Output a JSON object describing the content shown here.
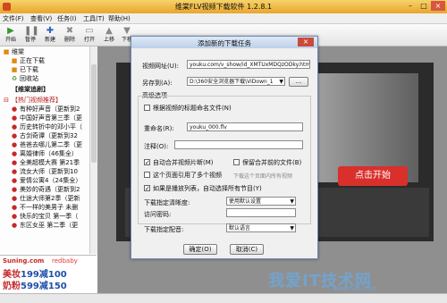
{
  "window": {
    "title": "维棠FLV视频下载软件 1.2.8.1"
  },
  "menu": [
    "文件(F)",
    "查看(V)",
    "任务(I)",
    "工具(T)",
    "帮助(H)"
  ],
  "toolbar": [
    "开始",
    "暂停",
    "新建",
    "删除",
    "打开",
    "上移",
    "下移"
  ],
  "sidebar": {
    "items": [
      {
        "label": "维棠",
        "level": 0
      },
      {
        "label": "正在下载",
        "level": 1
      },
      {
        "label": "已下载",
        "level": 1
      },
      {
        "label": "回收站",
        "level": 1
      },
      {
        "label": "【维棠追剧】",
        "level": 0
      },
      {
        "label": "【热门视频推荐】",
        "level": 0
      },
      {
        "label": "有种好声音（更新到2",
        "level": 1
      },
      {
        "label": "中国好声音第三季（更",
        "level": 1
      },
      {
        "label": "历史转折中的邓小平（",
        "level": 1
      },
      {
        "label": "古剑奇谭（更新到32",
        "level": 1
      },
      {
        "label": "爸爸去哪儿第二季（更",
        "level": 1
      },
      {
        "label": "离婚律师（46集全）",
        "level": 1
      },
      {
        "label": "全美超模大赛 第21季",
        "level": 1
      },
      {
        "label": "流女大师（更新到10",
        "level": 1
      },
      {
        "label": "爱情公寓4（24集全）",
        "level": 1
      },
      {
        "label": "美妙的奇遇（更新到2",
        "level": 1
      },
      {
        "label": "仕途大师第2季（更新",
        "level": 1
      },
      {
        "label": "不一样的美男子 未删",
        "level": 1
      },
      {
        "label": "快乐的宝贝 第一季（",
        "level": 1
      },
      {
        "label": "东区女巫 第二季（更",
        "level": 1
      }
    ]
  },
  "ad": {
    "brand": "Suning.com",
    "brand2": "redbaby",
    "line1_prefix": "美妆",
    "line1_value": "199减100",
    "line2_prefix": "奶粉",
    "line2_value": "599减150"
  },
  "content": {
    "start_button": "点击开始"
  },
  "dialog": {
    "title": "添加新的下载任务",
    "url_label": "视频网址(U):",
    "url_value": "youku.com/v_show/id_XMTUxMDQzODky.html",
    "saveas_label": "另存到(A):",
    "saveas_value": "D:\\360安全浏览器下载\\ViDown_1",
    "browse_label": "...",
    "advanced_label": "高级选项",
    "rename_by_title_label": "根据视频的标题命名文件(N)",
    "rename_label": "重命名(R):",
    "rename_value": "youku_000.flv",
    "comment_label": "注释(O):",
    "comment_value": "",
    "auto_merge_label": "自动合并视频片断(M)",
    "keep_parts_label": "保留合并前的文件(B)",
    "page_multi_label": "这个页面引用了多个视频",
    "download_all_label": "下载这个页面内所有视频",
    "playlist_label": "如果是播放列表，自动选择所有节目(Y)",
    "quality_label": "下载指定清晰度:",
    "quality_value": "使用默认设置",
    "password_label": "访问密码:",
    "password_value": "",
    "audio_label": "下载指定配音:",
    "audio_value": "默认语言",
    "ok_label": "确定(O)",
    "cancel_label": "取消(C)",
    "checks": {
      "rename_by_title": false,
      "auto_merge": true,
      "keep_parts": false,
      "page_multi": false,
      "playlist": true
    }
  },
  "watermark": {
    "text": "我爱IT技术网",
    "url": "www.52ij.com"
  }
}
